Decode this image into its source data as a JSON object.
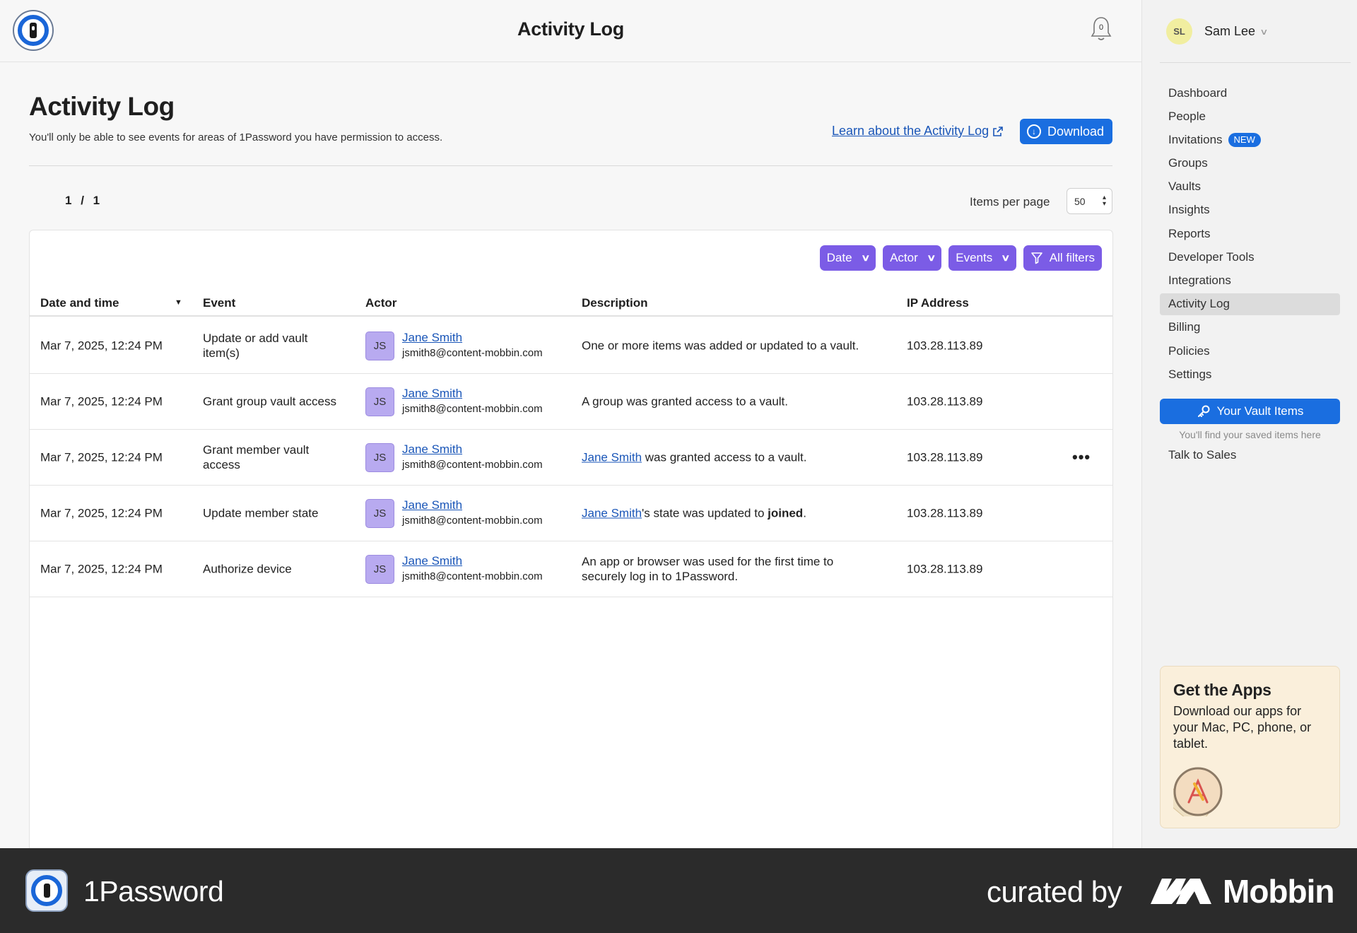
{
  "header": {
    "title": "Activity Log",
    "notification_count": "0"
  },
  "page": {
    "title": "Activity Log",
    "subtitle": "You'll only be able to see events for areas of 1Password you have permission to access.",
    "learn_link": "Learn about the Activity Log",
    "download_label": "Download"
  },
  "pagination": {
    "current": "1",
    "separator": "/",
    "total": "1",
    "items_per_page_label": "Items per page",
    "items_per_page_value": "50"
  },
  "filters": {
    "date": "Date",
    "actor": "Actor",
    "events": "Events",
    "all": "All filters"
  },
  "table": {
    "columns": [
      "Date and time",
      "Event",
      "Actor",
      "Description",
      "IP Address"
    ],
    "rows": [
      {
        "date": "Mar 7, 2025, 12:24 PM",
        "event": "Update or add vault item(s)",
        "actor_initials": "JS",
        "actor_name": "Jane Smith",
        "actor_email": "jsmith8@content-mobbin.com",
        "desc_link": "",
        "desc_text": "One or more items was added or updated to a vault.",
        "desc_bold": "",
        "desc_end": "",
        "ip": "103.28.113.89"
      },
      {
        "date": "Mar 7, 2025, 12:24 PM",
        "event": "Grant group vault access",
        "actor_initials": "JS",
        "actor_name": "Jane Smith",
        "actor_email": "jsmith8@content-mobbin.com",
        "desc_link": "",
        "desc_text": "A group was granted access to a vault.",
        "desc_bold": "",
        "desc_end": "",
        "ip": "103.28.113.89"
      },
      {
        "date": "Mar 7, 2025, 12:24 PM",
        "event": "Grant member vault access",
        "actor_initials": "JS",
        "actor_name": "Jane Smith",
        "actor_email": "jsmith8@content-mobbin.com",
        "desc_link": "Jane Smith",
        "desc_text": " was granted access to a vault.",
        "desc_bold": "",
        "desc_end": "",
        "ip": "103.28.113.89",
        "menu": "•••"
      },
      {
        "date": "Mar 7, 2025, 12:24 PM",
        "event": "Update member state",
        "actor_initials": "JS",
        "actor_name": "Jane Smith",
        "actor_email": "jsmith8@content-mobbin.com",
        "desc_link": "Jane Smith",
        "desc_text": "'s state was updated to ",
        "desc_bold": "joined",
        "desc_end": ".",
        "ip": "103.28.113.89"
      },
      {
        "date": "Mar 7, 2025, 12:24 PM",
        "event": "Authorize device",
        "actor_initials": "JS",
        "actor_name": "Jane Smith",
        "actor_email": "jsmith8@content-mobbin.com",
        "desc_link": "",
        "desc_text": "An app or browser was used for the first time to securely log in to 1Password.",
        "desc_bold": "",
        "desc_end": "",
        "ip": "103.28.113.89"
      }
    ]
  },
  "sidebar": {
    "user_initials": "SL",
    "user_name": "Sam Lee",
    "nav": [
      {
        "label": "Dashboard"
      },
      {
        "label": "People"
      },
      {
        "label": "Invitations",
        "badge": "NEW"
      },
      {
        "label": "Groups"
      },
      {
        "label": "Vaults"
      },
      {
        "label": "Insights"
      },
      {
        "label": "Reports"
      },
      {
        "label": "Developer Tools"
      },
      {
        "label": "Integrations"
      },
      {
        "label": "Activity Log",
        "active": true
      },
      {
        "label": "Billing"
      },
      {
        "label": "Policies"
      },
      {
        "label": "Settings"
      }
    ],
    "vault_button": "Your Vault Items",
    "vault_hint": "You'll find your saved items here",
    "talk_to_sales": "Talk to Sales",
    "apps_card": {
      "title": "Get the Apps",
      "text": "Download our apps for your Mac, PC, phone, or tablet."
    }
  },
  "footer": {
    "brand": "1Password",
    "curated": "curated by",
    "mobbin": "Mobbin"
  },
  "colors": {
    "accent_blue": "#1a6ee0",
    "filter_purple": "#7b5ce6",
    "link_blue": "#1a56b8",
    "avatar_purple": "#b8aaf0",
    "badge_blue": "#1a6ee0",
    "footer_dark": "#2b2b2b"
  },
  "icons": {
    "bell": "bell-icon",
    "download": "download-circle-icon",
    "external": "external-link-icon",
    "sort": "sort-desc-icon",
    "filter": "funnel-icon",
    "chevron": "chevron-down-icon",
    "key": "key-icon",
    "more": "more-horizontal-icon"
  }
}
